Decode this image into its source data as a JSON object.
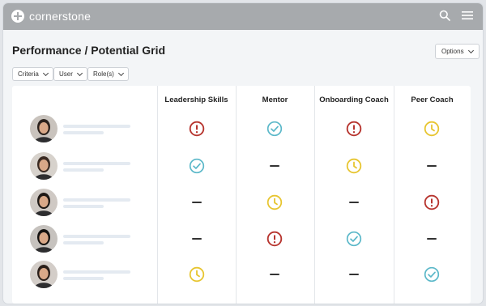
{
  "app": {
    "brand": "cornerstone"
  },
  "page": {
    "title": "Performance / Potential Grid"
  },
  "filters": [
    {
      "label": "Criteria"
    },
    {
      "label": "User"
    },
    {
      "label": "Role(s)"
    }
  ],
  "options_label": "Options",
  "columns": [
    "Leadership Skills",
    "Mentor",
    "Onboarding Coach",
    "Peer Coach"
  ],
  "rows": [
    {
      "statuses": [
        "alert",
        "check",
        "alert",
        "pending"
      ]
    },
    {
      "statuses": [
        "check",
        "none",
        "pending",
        "none"
      ]
    },
    {
      "statuses": [
        "none",
        "pending",
        "none",
        "alert"
      ]
    },
    {
      "statuses": [
        "none",
        "alert",
        "check",
        "none"
      ]
    },
    {
      "statuses": [
        "pending",
        "none",
        "none",
        "check"
      ]
    }
  ],
  "status_colors": {
    "alert": "#b7352f",
    "check": "#5bb8c9",
    "pending": "#e7c530"
  },
  "icons": {
    "search": "search-icon",
    "menu": "menu-icon"
  }
}
